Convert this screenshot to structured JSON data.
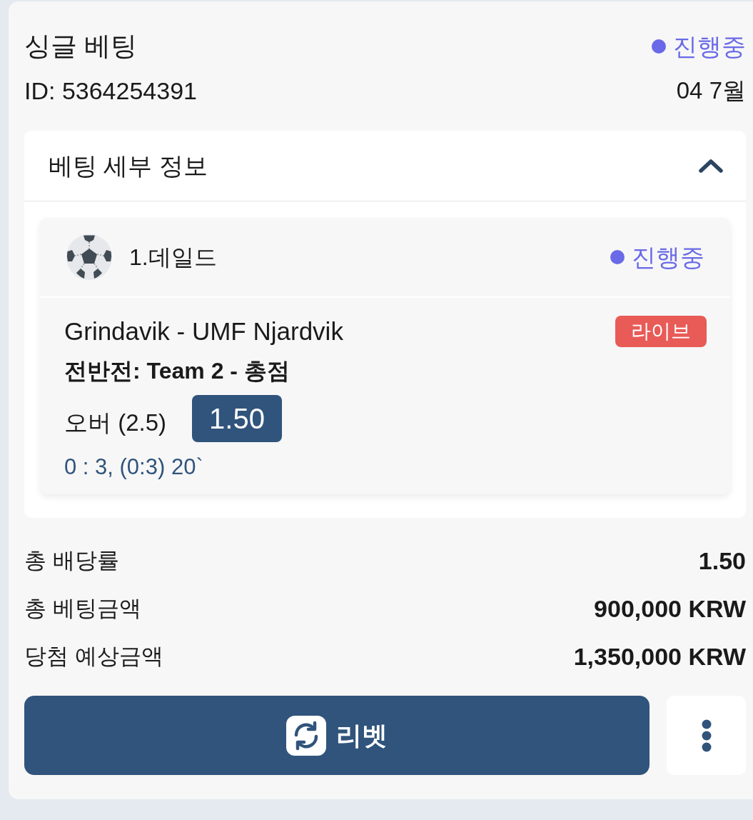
{
  "bet": {
    "title": "싱글 베팅",
    "status": {
      "label": "진행중",
      "kind": "in_progress"
    },
    "id": "ID: 5364254391",
    "date": "04 7월"
  },
  "details": {
    "title": "베팅 세부 정보",
    "expanded": true,
    "selections": [
      {
        "kind": "soccer",
        "name": "1.데일드",
        "status": {
          "label": "진행중",
          "kind": "in_progress"
        },
        "match": "Grindavik - UMF Njardvik",
        "badge": "라이브",
        "market": "전반전: Team 2 - 총점",
        "pick": "오버 (2.5)",
        "odds": "1.50",
        "score": "0 : 3, (0:3) 20`"
      }
    ]
  },
  "summary": [
    {
      "label": "총 배당률",
      "value": "1.50"
    },
    {
      "label": "총 베팅금액",
      "value": "900,000 KRW"
    },
    {
      "label": "당첨 예상금액",
      "value": "1,350,000 KRW"
    }
  ],
  "actions": {
    "rebet": "리벳"
  }
}
